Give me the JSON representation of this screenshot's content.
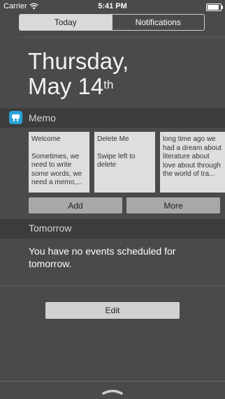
{
  "status_bar": {
    "carrier": "Carrier",
    "time": "5:41 PM",
    "battery_level": 1.0,
    "wifi_icon": "wifi-icon"
  },
  "segmented": {
    "today": "Today",
    "notifications": "Notifications"
  },
  "date": {
    "line1": "Thursday,",
    "line2_main": "May 14",
    "line2_suffix": "th"
  },
  "memo": {
    "title": "Memo",
    "icon": "memo-app-icon",
    "notes": [
      {
        "title": "Welcome",
        "body": "Sometimes, we need to write some words, we need a memo,..."
      },
      {
        "title": "Delete Me",
        "body": "Swipe left to delete"
      },
      {
        "title": "",
        "body": "long time ago we had a dream about literature about love about through the world of tra..."
      }
    ],
    "add_label": "Add",
    "more_label": "More"
  },
  "tomorrow": {
    "title": "Tomorrow",
    "message": "You have no events scheduled for tomorrow."
  },
  "edit_label": "Edit",
  "grabber_icon": "chevron-handle-icon",
  "colors": {
    "background": "#4a4a4a",
    "band": "#3c3c3c",
    "accent": "#29a3d8"
  }
}
